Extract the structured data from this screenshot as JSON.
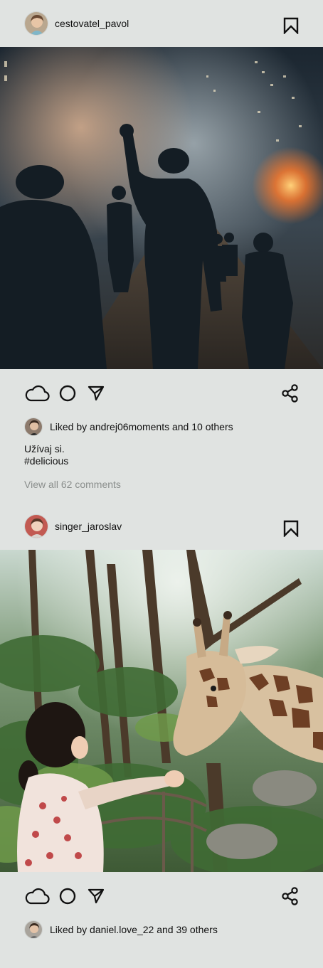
{
  "posts": [
    {
      "username": "cestovatel_pavol",
      "liked_by_user": "andrej06moments",
      "liked_text": "Liked by andrej06moments and 10 others",
      "caption_line1": "Užívaj si.",
      "caption_line2": "#delicious",
      "view_comments": "View all 62 comments",
      "image_subject": "riot police silhouettes in smoky city street at night"
    },
    {
      "username": "singer_jaroslav",
      "liked_text": "Liked by daniel.love_22 and 39 others",
      "image_subject": "little girl reaching toward a giraffe in a lush zoo enclosure"
    }
  ],
  "icons": {
    "like": "cloud-icon",
    "comment": "circle-icon",
    "share_dm": "send-icon",
    "share": "share-icon",
    "save": "bookmark-icon"
  },
  "colors": {
    "background": "#e0e3e1",
    "muted_text": "#8a8e8c"
  }
}
